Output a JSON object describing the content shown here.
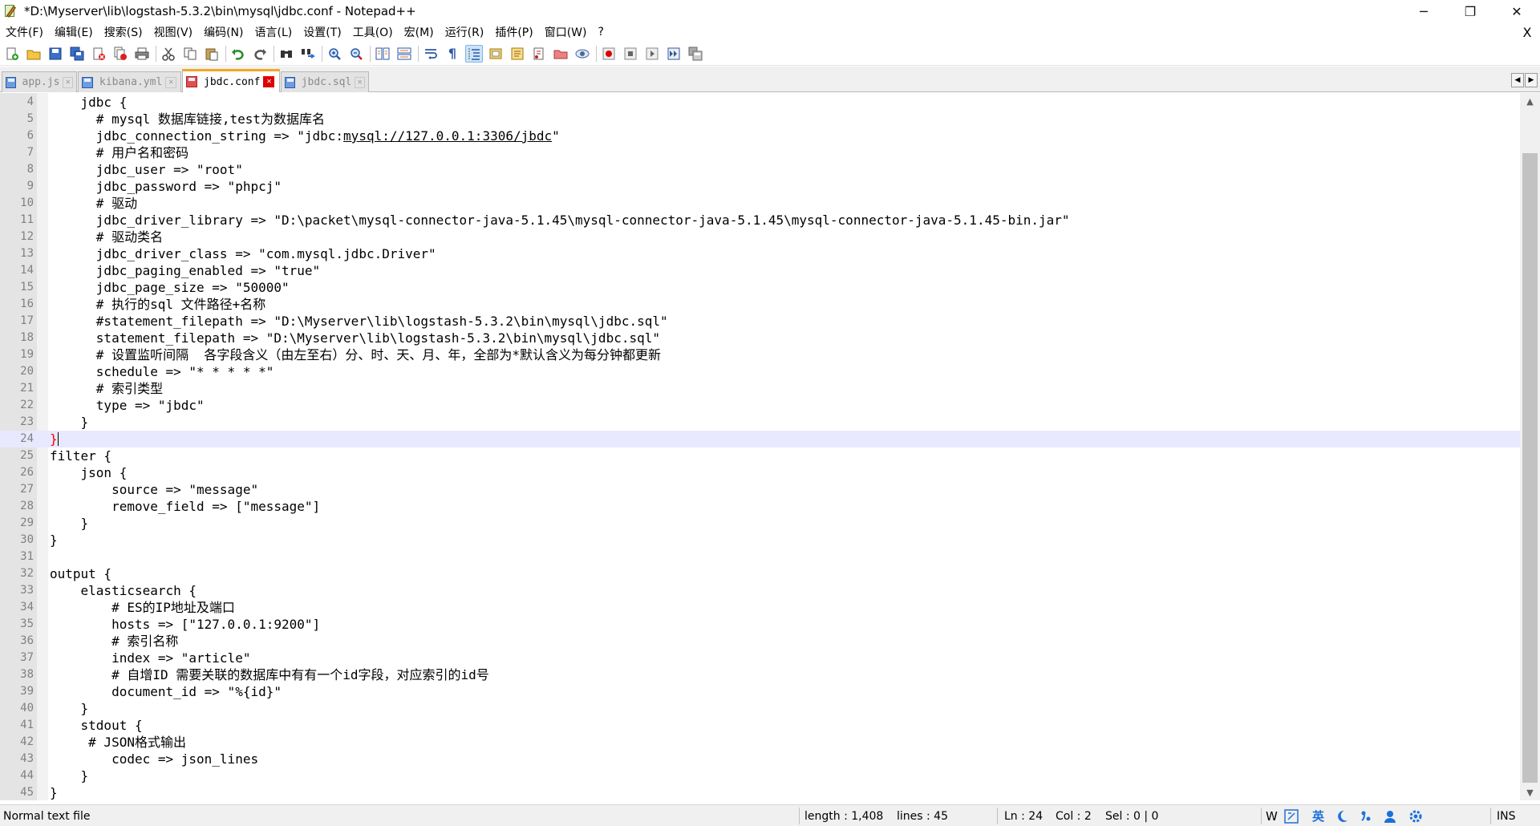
{
  "window": {
    "title": "*D:\\Myserver\\lib\\logstash-5.3.2\\bin\\mysql\\jdbc.conf - Notepad++",
    "minimize": "─",
    "maximize": "❐",
    "close": "✕"
  },
  "menu": {
    "items": [
      "文件(F)",
      "编辑(E)",
      "搜索(S)",
      "视图(V)",
      "编码(N)",
      "语言(L)",
      "设置(T)",
      "工具(O)",
      "宏(M)",
      "运行(R)",
      "插件(P)",
      "窗口(W)",
      "?"
    ],
    "close": "X"
  },
  "toolbar": {
    "icons": [
      "new-file-icon",
      "open-file-icon",
      "save-icon",
      "save-all-icon",
      "close-icon",
      "close-all-icon",
      "print-icon",
      "cut-icon",
      "copy-icon",
      "paste-icon",
      "undo-icon",
      "redo-icon",
      "find-icon",
      "replace-icon",
      "zoom-in-icon",
      "zoom-out-icon",
      "sync-vertical-icon",
      "sync-horizontal-icon",
      "word-wrap-icon",
      "show-all-chars-icon",
      "indent-guide-icon",
      "doc-map-icon",
      "function-list-icon",
      "folder-workspace-icon",
      "monitor-icon",
      "record-macro-icon",
      "stop-macro-icon",
      "play-macro-icon",
      "run-macro-multiple-icon",
      "save-macro-icon"
    ]
  },
  "tabs": [
    {
      "label": "app.js",
      "active": false
    },
    {
      "label": "kibana.yml",
      "active": false
    },
    {
      "label": "jbdc.conf",
      "active": true
    },
    {
      "label": "jbdc.sql",
      "active": false
    }
  ],
  "editor": {
    "current_line": 24,
    "lines": [
      {
        "n": "4",
        "text": "    jdbc {"
      },
      {
        "n": "5",
        "text": "      # mysql 数据库链接,test为数据库名"
      },
      {
        "n": "6",
        "pre": "      jdbc_connection_string => \"jdbc:",
        "link": "mysql://127.0.0.1:3306/jbdc",
        "post": "\""
      },
      {
        "n": "7",
        "text": "      # 用户名和密码"
      },
      {
        "n": "8",
        "text": "      jdbc_user => \"root\""
      },
      {
        "n": "9",
        "text": "      jdbc_password => \"phpcj\""
      },
      {
        "n": "10",
        "text": "      # 驱动"
      },
      {
        "n": "11",
        "text": "      jdbc_driver_library => \"D:\\packet\\mysql-connector-java-5.1.45\\mysql-connector-java-5.1.45\\mysql-connector-java-5.1.45-bin.jar\""
      },
      {
        "n": "12",
        "text": "      # 驱动类名"
      },
      {
        "n": "13",
        "text": "      jdbc_driver_class => \"com.mysql.jdbc.Driver\""
      },
      {
        "n": "14",
        "text": "      jdbc_paging_enabled => \"true\""
      },
      {
        "n": "15",
        "text": "      jdbc_page_size => \"50000\""
      },
      {
        "n": "16",
        "text": "      # 执行的sql 文件路径+名称"
      },
      {
        "n": "17",
        "text": "      #statement_filepath => \"D:\\Myserver\\lib\\logstash-5.3.2\\bin\\mysql\\jdbc.sql\""
      },
      {
        "n": "18",
        "text": "      statement_filepath => \"D:\\Myserver\\lib\\logstash-5.3.2\\bin\\mysql\\jdbc.sql\""
      },
      {
        "n": "19",
        "text": "      # 设置监听间隔  各字段含义（由左至右）分、时、天、月、年，全部为*默认含义为每分钟都更新"
      },
      {
        "n": "20",
        "text": "      schedule => \"* * * * *\""
      },
      {
        "n": "21",
        "text": "      # 索引类型"
      },
      {
        "n": "22",
        "text": "      type => \"jbdc\""
      },
      {
        "n": "23",
        "text": "    }"
      },
      {
        "n": "24",
        "text": "}",
        "brace": true
      },
      {
        "n": "25",
        "text": "filter {"
      },
      {
        "n": "26",
        "text": "    json {"
      },
      {
        "n": "27",
        "text": "        source => \"message\""
      },
      {
        "n": "28",
        "text": "        remove_field => [\"message\"]"
      },
      {
        "n": "29",
        "text": "    }"
      },
      {
        "n": "30",
        "text": "}"
      },
      {
        "n": "31",
        "text": ""
      },
      {
        "n": "32",
        "text": "output {"
      },
      {
        "n": "33",
        "text": "    elasticsearch {"
      },
      {
        "n": "34",
        "text": "        # ES的IP地址及端口"
      },
      {
        "n": "35",
        "text": "        hosts => [\"127.0.0.1:9200\"]"
      },
      {
        "n": "36",
        "text": "        # 索引名称"
      },
      {
        "n": "37",
        "text": "        index => \"article\""
      },
      {
        "n": "38",
        "text": "        # 自增ID 需要关联的数据库中有有一个id字段，对应索引的id号"
      },
      {
        "n": "39",
        "text": "        document_id => \"%{id}\""
      },
      {
        "n": "40",
        "text": "    }"
      },
      {
        "n": "41",
        "text": "    stdout {"
      },
      {
        "n": "42",
        "text": "     # JSON格式输出"
      },
      {
        "n": "43",
        "text": "        codec => json_lines"
      },
      {
        "n": "44",
        "text": "    }"
      },
      {
        "n": "45",
        "text": "}"
      }
    ]
  },
  "statusbar": {
    "file_type": "Normal text file",
    "length": "length : 1,408",
    "lines": "lines : 45",
    "ln": "Ln : 24",
    "col": "Col : 2",
    "sel": "Sel : 0 | 0",
    "ime_w": "W",
    "ime_lang": "英",
    "mode": "INS"
  }
}
